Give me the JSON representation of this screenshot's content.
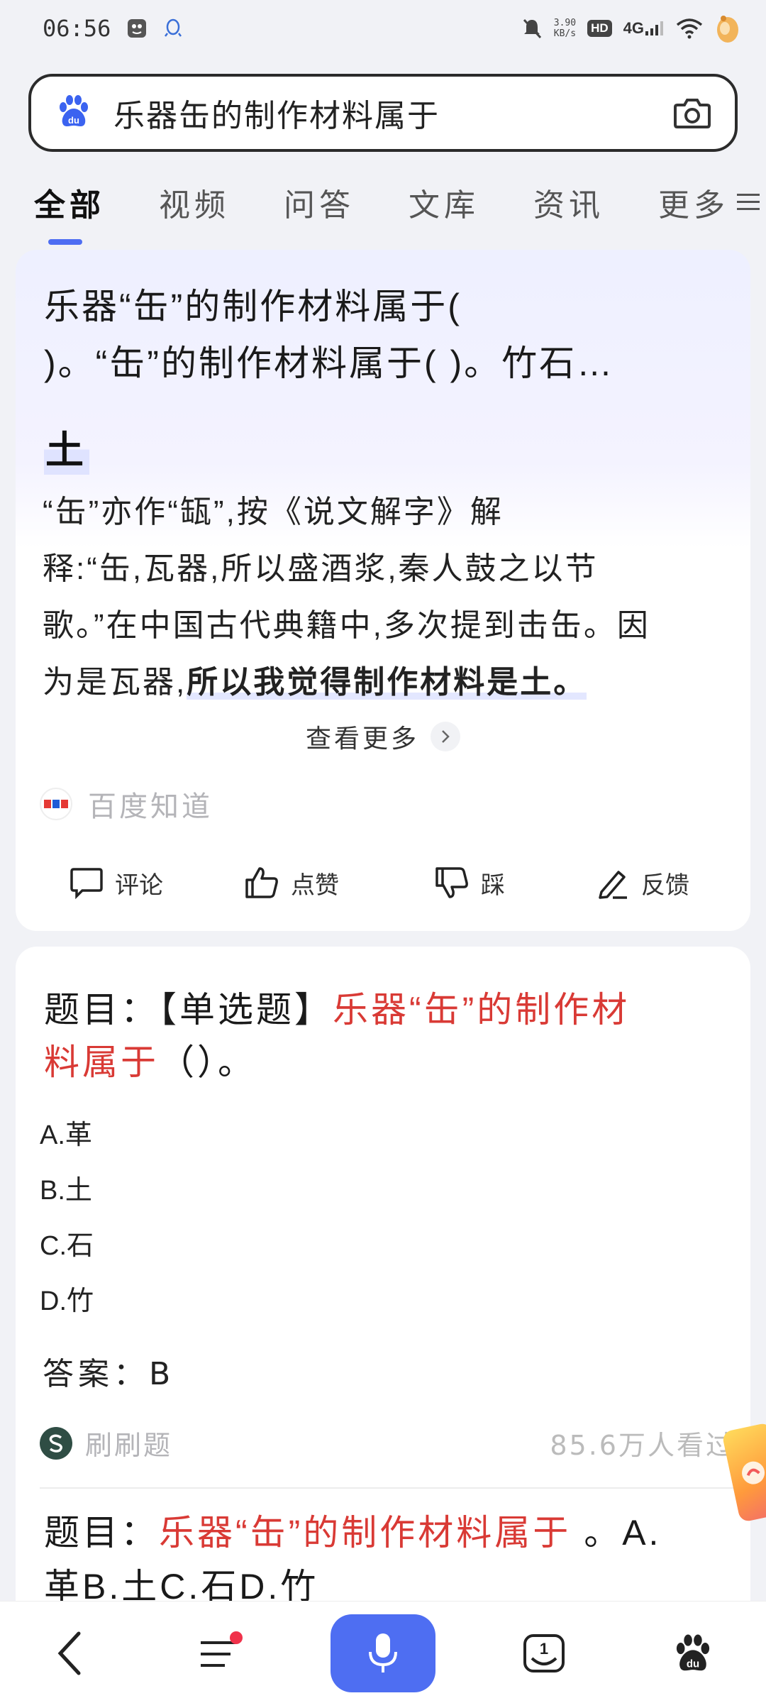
{
  "status_bar": {
    "time": "06:56",
    "net_speed_value": "3.90",
    "net_speed_unit": "KB/s",
    "hd_badge": "HD",
    "network": "4G"
  },
  "search": {
    "query": "乐器缶的制作材料属于"
  },
  "tabs": [
    {
      "label": "全部",
      "active": true
    },
    {
      "label": "视频",
      "active": false
    },
    {
      "label": "问答",
      "active": false
    },
    {
      "label": "文库",
      "active": false
    },
    {
      "label": "资讯",
      "active": false
    },
    {
      "label": "更多",
      "active": false
    }
  ],
  "card1": {
    "title_line1": "乐器“缶”的制作材料属于(",
    "title_line2": ")。“缶”的制作材料属于( )。竹石…",
    "answer": "土",
    "body_lines": [
      "“缶”亦作“缻”,按《说文解字》解",
      "释:“缶,瓦器,所以盛酒浆,秦人鼓之以节",
      "歌。”在中国古代典籍中,多次提到击缶。因"
    ],
    "body_line4_plain": "为是瓦器,",
    "body_line4_highlight": "所以我觉得制作材料是土。",
    "see_more": "查看更多",
    "source": "百度知道",
    "actions": {
      "comment": "评论",
      "like": "点赞",
      "dislike": "踩",
      "feedback": "反馈"
    }
  },
  "card2": {
    "q_prefix": "题目：【单选题】",
    "q_red": "乐器“缶”的制作材",
    "q_red2": "料属于",
    "q_suffix": "（）。",
    "options": [
      "A.革",
      "B.土",
      "C.石",
      "D.竹"
    ],
    "answer": "答案：B",
    "source": "刷刷题",
    "views": "85.6万人看过",
    "q2_prefix": "题目：",
    "q2_red": "乐器“缶”的制作材料属于",
    "q2_suffix": " 。A.",
    "q2_line2": "革B.土C.石D.竹"
  },
  "colors": {
    "accent": "#4e6ef2",
    "highlight_red": "#d93a35",
    "notification_dot": "#f0324b"
  }
}
